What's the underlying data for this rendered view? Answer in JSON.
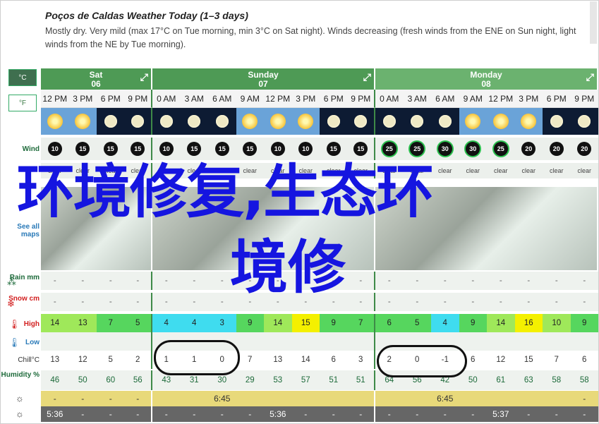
{
  "header": {
    "title": "Poços de Caldas Weather Today (1–3 days)",
    "summary": "Mostly dry. Very mild (max 17°C on Tue morning, min 3°C on Sat night). Winds decreasing (fresh winds from the ENE on Sun night, light winds from the NE by Tue morning)."
  },
  "units": {
    "c": "°C",
    "f": "°F"
  },
  "side": {
    "wind": "Wind",
    "maps": "See all maps",
    "rain": "Rain mm",
    "snow": "Snow cm",
    "high": "High",
    "low": "Low",
    "chill": "Chill°C",
    "humidity": "Humidity %"
  },
  "days": [
    {
      "name": "Sat",
      "date": "06"
    },
    {
      "name": "Sunday",
      "date": "07"
    },
    {
      "name": "Monday",
      "date": "08"
    }
  ],
  "times": [
    "12 PM",
    "3 PM",
    "6 PM",
    "9 PM",
    "0 AM",
    "3 AM",
    "6 AM",
    "9 AM",
    "12 PM",
    "3 PM",
    "6 PM",
    "9 PM",
    "0 AM",
    "3 AM",
    "6 AM",
    "9 AM",
    "12 PM",
    "3 PM",
    "6 PM",
    "9 PM"
  ],
  "sky": [
    "sun",
    "sun",
    "moon",
    "moon",
    "moon",
    "moon",
    "moon",
    "sun",
    "sun",
    "sun",
    "moon",
    "moon",
    "moon",
    "moon",
    "moon",
    "sun",
    "sun",
    "sun",
    "moon",
    "moon"
  ],
  "wind": [
    "10",
    "15",
    "15",
    "15",
    "10",
    "15",
    "15",
    "15",
    "10",
    "10",
    "15",
    "15",
    "25",
    "25",
    "30",
    "30",
    "25",
    "20",
    "20",
    "20"
  ],
  "conditions": [
    "clear",
    "clear",
    "clear",
    "clear",
    "clear",
    "clear",
    "clear",
    "clear",
    "clear",
    "clear",
    "clear",
    "clear",
    "clear",
    "clear",
    "clear",
    "clear",
    "clear",
    "clear",
    "clear",
    "clear"
  ],
  "rain": [
    "-",
    "-",
    "-",
    "-",
    "-",
    "-",
    "-",
    "-",
    "-",
    "-",
    "-",
    "-",
    "-",
    "-",
    "-",
    "-",
    "-",
    "-",
    "-",
    "-"
  ],
  "snow": [
    "-",
    "-",
    "-",
    "-",
    "-",
    "-",
    "-",
    "-",
    "-",
    "-",
    "-",
    "-",
    "-",
    "-",
    "-",
    "-",
    "-",
    "-",
    "-",
    "-"
  ],
  "high": [
    "14",
    "13",
    "7",
    "5",
    "4",
    "4",
    "3",
    "9",
    "14",
    "15",
    "9",
    "7",
    "6",
    "5",
    "4",
    "9",
    "14",
    "16",
    "10",
    "9"
  ],
  "high_colors": [
    "#9fe85a",
    "#9fe85a",
    "#56d65e",
    "#56d65e",
    "#3fdcef",
    "#3fdcef",
    "#3fdcef",
    "#56d65e",
    "#9fe85a",
    "#f4f000",
    "#56d65e",
    "#56d65e",
    "#56d65e",
    "#56d65e",
    "#3fdcef",
    "#56d65e",
    "#9fe85a",
    "#f4f000",
    "#9fe85a",
    "#56d65e"
  ],
  "low": [
    "",
    "",
    "",
    "",
    "",
    "",
    "",
    "",
    "",
    "",
    "",
    "",
    "",
    "",
    "",
    "",
    "",
    "",
    "",
    ""
  ],
  "chill": [
    "13",
    "12",
    "5",
    "2",
    "1",
    "1",
    "0",
    "7",
    "13",
    "14",
    "6",
    "3",
    "2",
    "0",
    "-1",
    "6",
    "12",
    "15",
    "7",
    "6"
  ],
  "humidity": [
    "46",
    "50",
    "60",
    "56",
    "43",
    "31",
    "30",
    "29",
    "53",
    "57",
    "51",
    "51",
    "64",
    "56",
    "42",
    "50",
    "61",
    "63",
    "58",
    "58"
  ],
  "sunrise": [
    "-",
    "-",
    "-",
    "-",
    "",
    "",
    "6:45",
    "",
    "",
    "",
    "",
    "",
    "",
    "",
    "6:45",
    "",
    "",
    "",
    "",
    "-"
  ],
  "sunset": [
    "5:36",
    "-",
    "-",
    "-",
    "-",
    "-",
    "-",
    "-",
    "5:36",
    "-",
    "-",
    "-",
    "-",
    "-",
    "-",
    "-",
    "5:37",
    "-",
    "-",
    "-"
  ],
  "overlay": {
    "line1": "环境修复,生态环",
    "line2": "境修"
  }
}
